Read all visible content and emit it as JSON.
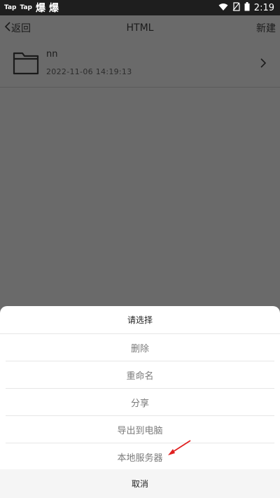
{
  "status_bar": {
    "app1": "Tap",
    "app2": "Tap",
    "app3": "爆",
    "app4": "爆",
    "time": "2:19"
  },
  "nav": {
    "back_label": "返回",
    "title": "HTML",
    "new_label": "新建"
  },
  "files": [
    {
      "name": "nn",
      "date": "2022-11-06 14:19:13"
    }
  ],
  "sheet": {
    "title": "请选择",
    "options": [
      "删除",
      "重命名",
      "分享",
      "导出到电脑",
      "本地服务器"
    ],
    "cancel": "取消"
  },
  "colors": {
    "overlay": "#6a6a6a",
    "status_bar": "#1e1e1e",
    "arrow": "#e02020"
  }
}
